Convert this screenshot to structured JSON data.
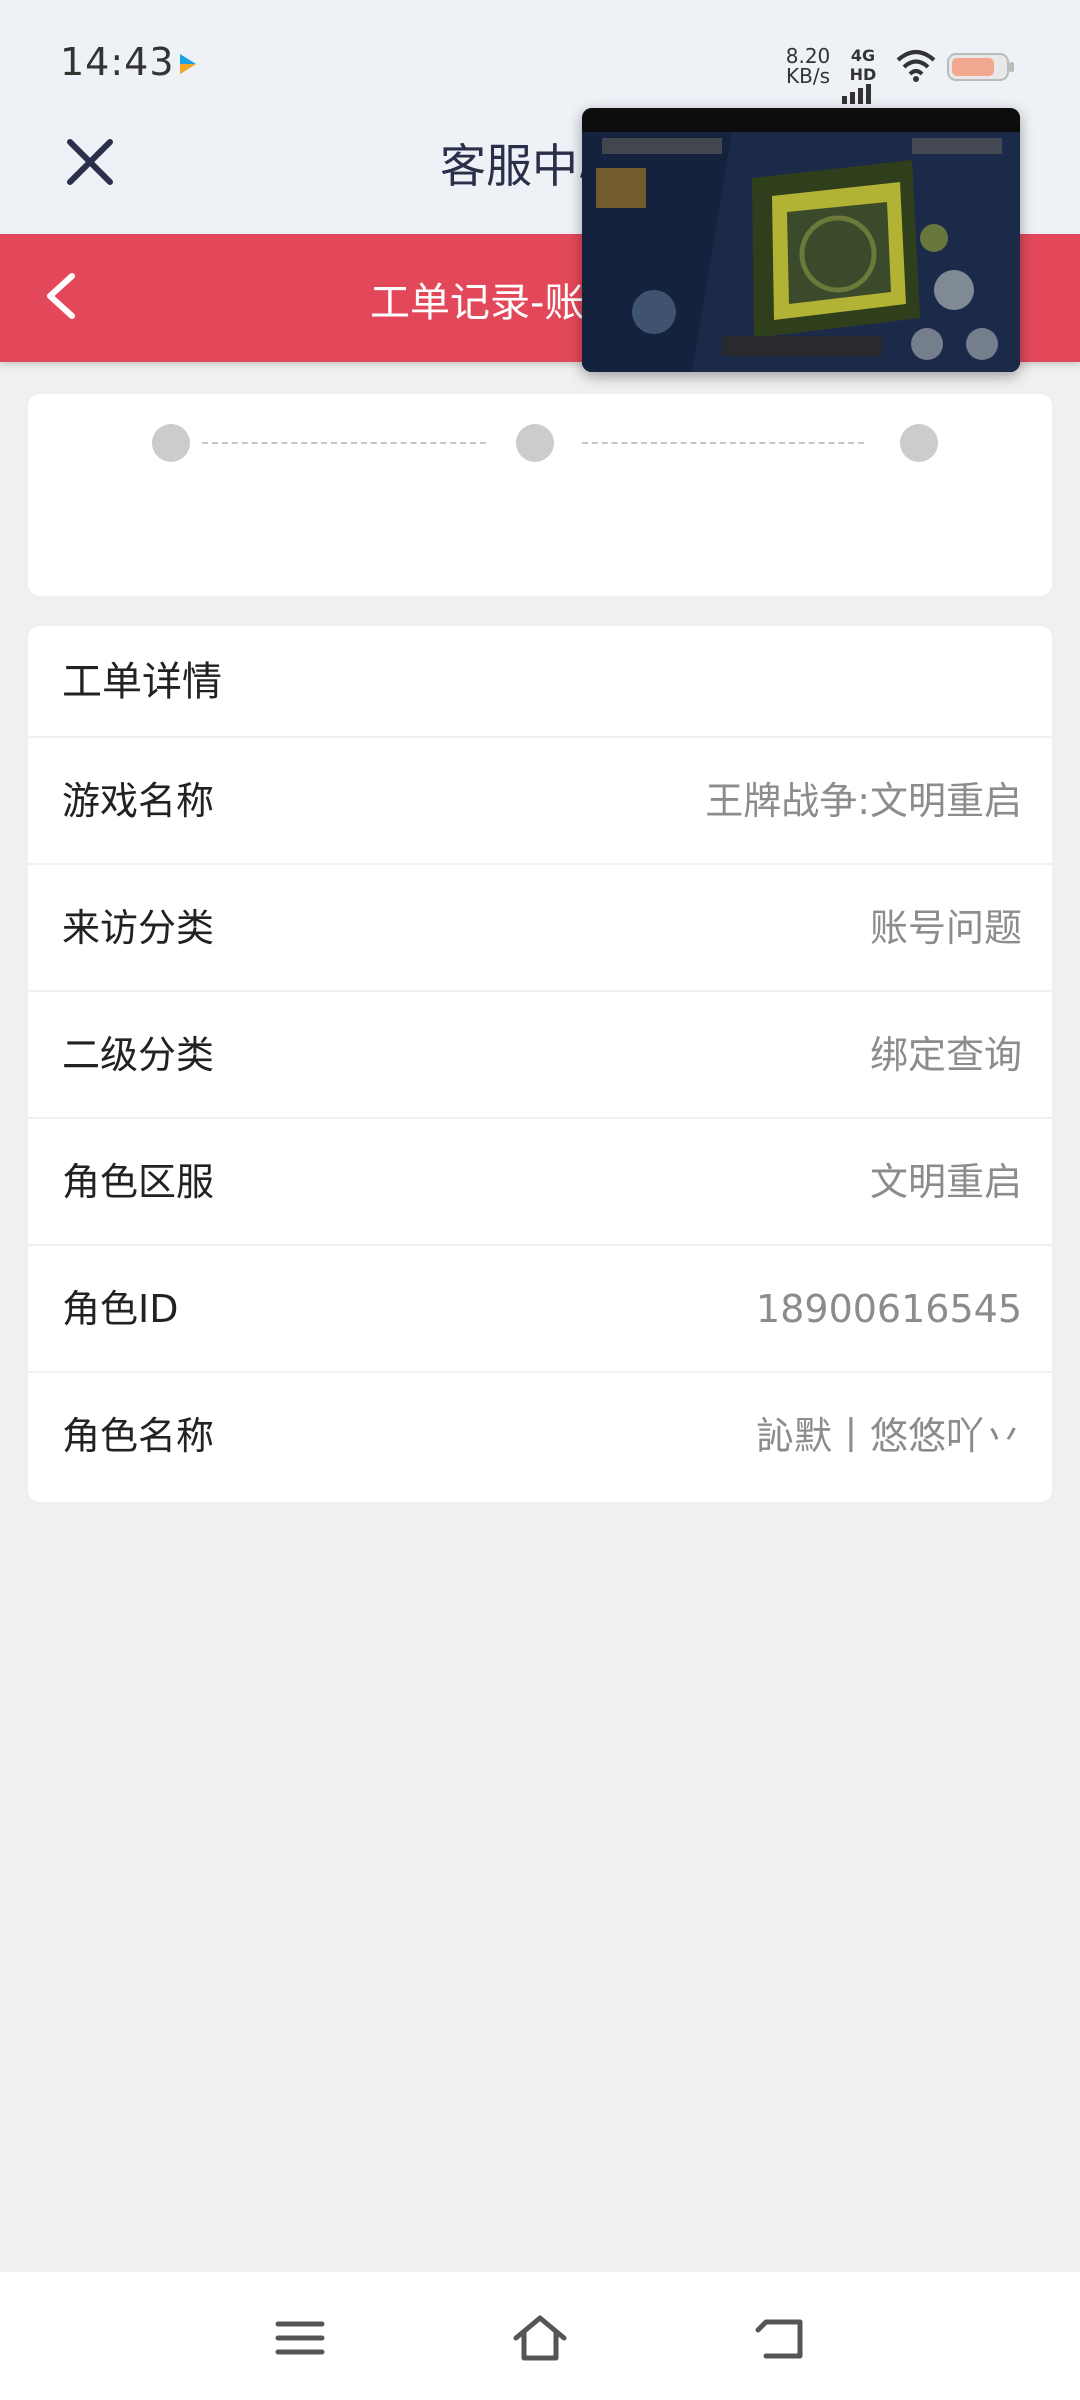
{
  "status_bar": {
    "time": "14:43",
    "net_speed_value": "8.20",
    "net_speed_unit": "KB/s",
    "signal_label": "4G HD"
  },
  "header": {
    "title": "客服中心"
  },
  "sub_header": {
    "title": "工单记录-账号问题"
  },
  "detail": {
    "section_title": "工单详情",
    "rows": [
      {
        "label": "游戏名称",
        "value": "王牌战争:文明重启"
      },
      {
        "label": "来访分类",
        "value": "账号问题"
      },
      {
        "label": "二级分类",
        "value": "绑定查询"
      },
      {
        "label": "角色区服",
        "value": "文明重启"
      },
      {
        "label": "角色ID",
        "value": "18900616545"
      },
      {
        "label": "角色名称",
        "value": "訫默丨悠悠吖丷"
      }
    ]
  },
  "colors": {
    "accent": "#e3485a",
    "background": "#f0f0f0",
    "header_bg": "#eef2f7"
  }
}
